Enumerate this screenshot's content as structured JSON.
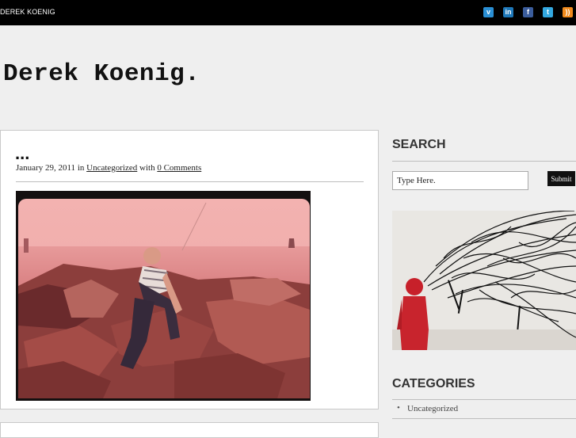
{
  "header": {
    "site_name": "DEREK KOENIG",
    "social": [
      {
        "name": "vimeo-icon",
        "glyph": "v",
        "color": "#2a8fd4"
      },
      {
        "name": "linkedin-icon",
        "glyph": "in",
        "color": "#1e78b9"
      },
      {
        "name": "facebook-icon",
        "glyph": "f",
        "color": "#3b5d9c"
      },
      {
        "name": "twitter-icon",
        "glyph": "t",
        "color": "#33a8e0"
      },
      {
        "name": "rss-icon",
        "glyph": "))",
        "color": "#f08a1c"
      }
    ]
  },
  "site_title": "Derek Koenig.",
  "post": {
    "title": "...",
    "date": "January 29, 2011",
    "in_text": "in",
    "category": "Uncategorized",
    "with_text": "with",
    "comments": "0 Comments"
  },
  "sidebar": {
    "search_title": "SEARCH",
    "search_value": "Type Here.",
    "submit_label": "Submit",
    "categories_title": "CATEGORIES",
    "categories": [
      "Uncategorized"
    ]
  }
}
